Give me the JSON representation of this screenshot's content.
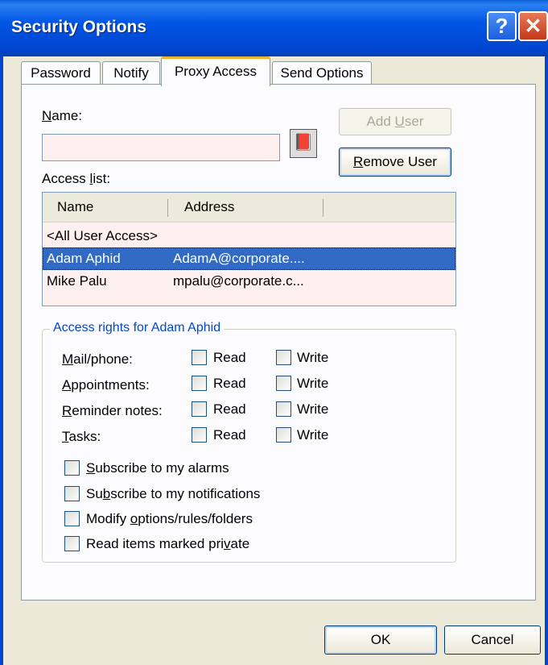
{
  "window": {
    "title": "Security Options",
    "help_glyph": "?",
    "close_glyph": "✕"
  },
  "tabs": [
    "Password",
    "Notify",
    "Proxy Access",
    "Send Options"
  ],
  "active_tab": "Proxy Access",
  "name_label": {
    "before": "",
    "accel": "N",
    "after": "ame:"
  },
  "name_value": "",
  "add_user": {
    "before": "Add ",
    "accel": "U",
    "after": "ser"
  },
  "remove_user": {
    "before": "",
    "accel": "R",
    "after": "emove User"
  },
  "access_list_label": {
    "before": "Access ",
    "accel": "l",
    "after": "ist:"
  },
  "list_columns": [
    "Name",
    "Address"
  ],
  "list_rows": [
    {
      "name": "<All User Access>",
      "address": ""
    },
    {
      "name": "Adam Aphid",
      "address": "AdamA@corporate....",
      "selected": true
    },
    {
      "name": "Mike Palu",
      "address": "mpalu@corporate.c..."
    }
  ],
  "group_title": "Access rights for Adam Aphid",
  "rights": [
    {
      "before": "",
      "accel": "M",
      "after": "ail/phone:",
      "read": "Read",
      "write": "Write"
    },
    {
      "before": "",
      "accel": "A",
      "after": "ppointments:",
      "read": "Read",
      "write": "Write"
    },
    {
      "before": "",
      "accel": "R",
      "after": "eminder notes:",
      "read": "Read",
      "write": "Write"
    },
    {
      "before": "",
      "accel": "T",
      "after": "asks:",
      "read": "Read",
      "write": "Write"
    }
  ],
  "options": [
    {
      "before": "",
      "accel": "S",
      "after": "ubscribe to my alarms"
    },
    {
      "before": "Su",
      "accel": "b",
      "after": "scribe to my notifications"
    },
    {
      "before": "Modify ",
      "accel": "o",
      "after": "ptions/rules/folders"
    },
    {
      "before": "Read items marked pri",
      "accel": "v",
      "after": "ate"
    }
  ],
  "ok_label": "OK",
  "cancel_label": "Cancel"
}
